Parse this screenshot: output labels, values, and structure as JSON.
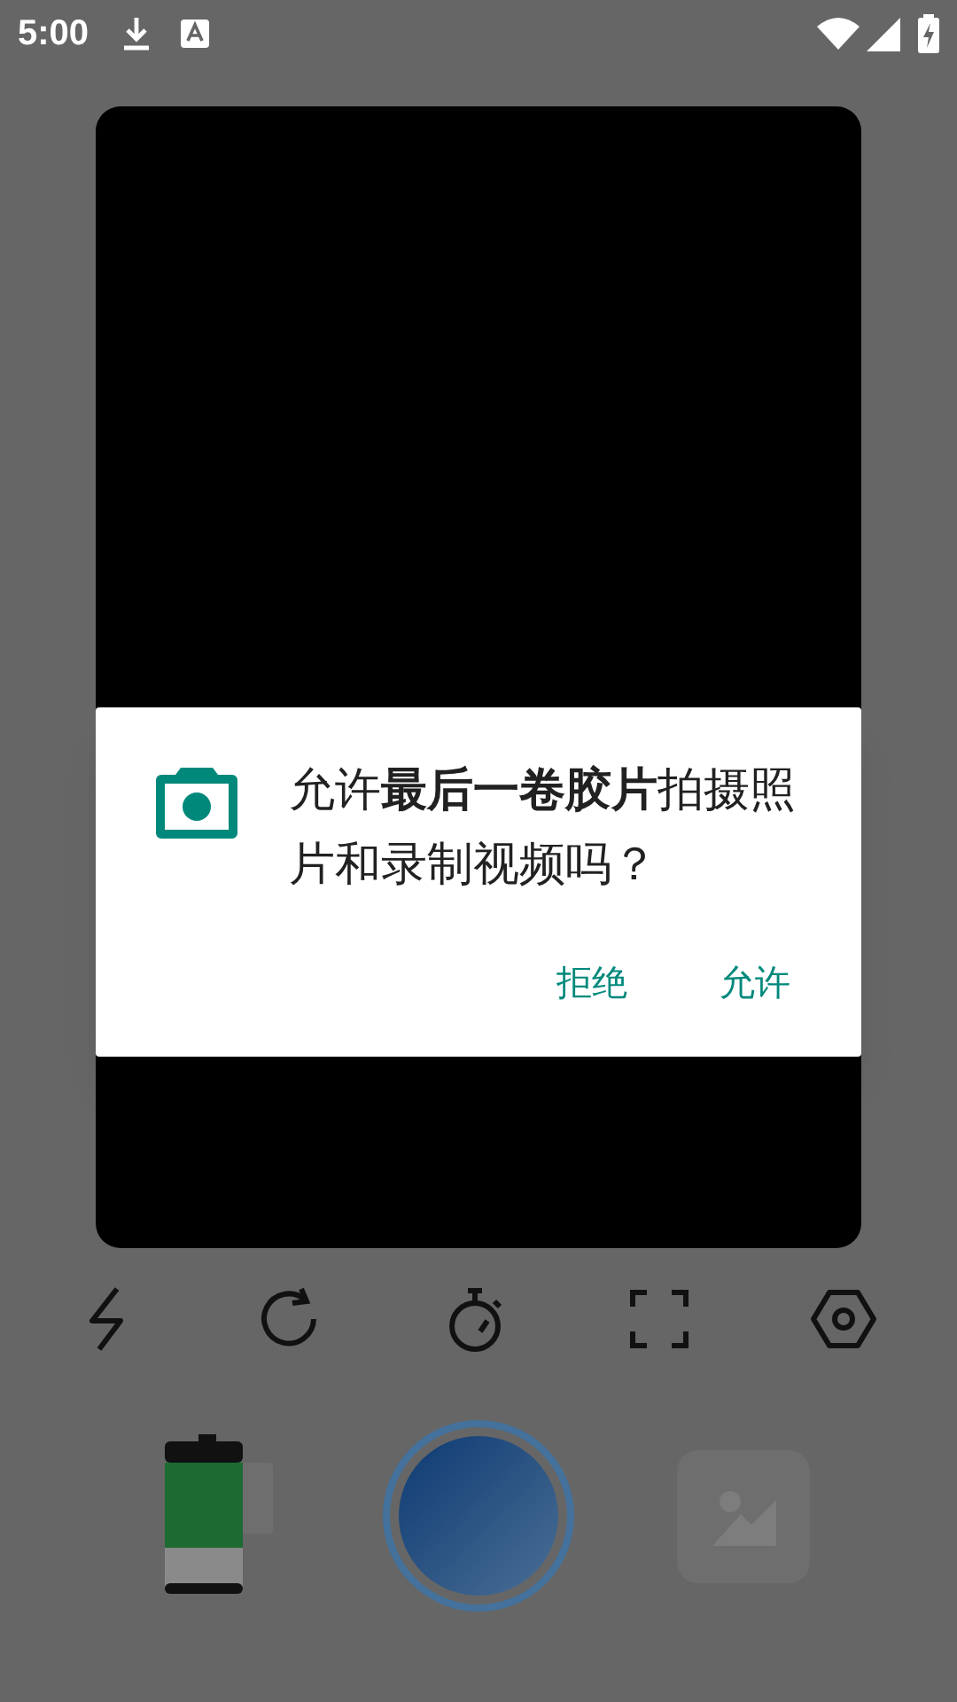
{
  "status_bar": {
    "time": "5:00"
  },
  "dialog": {
    "message": "允许**最后一卷胶片**拍摄照片和录制视频吗？",
    "buttons": [
      {
        "label": "拒绝"
      },
      {
        "label": "允许"
      }
    ]
  }
}
